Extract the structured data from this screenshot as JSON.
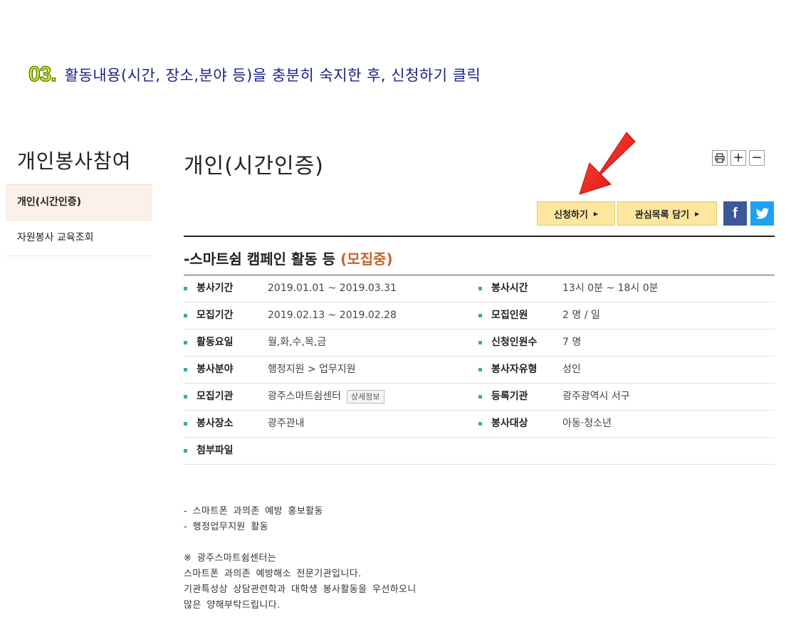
{
  "instruction": {
    "step": "03.",
    "text": "활동내용(시간, 장소,분야 등)을 충분히 숙지한 후, 신청하기 클릭"
  },
  "sidebar": {
    "title": "개인봉사참여",
    "items": [
      {
        "label": "개인(시간인증)",
        "active": true
      },
      {
        "label": "자원봉사 교육조회",
        "active": false
      }
    ]
  },
  "main": {
    "title": "개인(시간인증)",
    "tools": [
      {
        "icon": "print-icon",
        "symbol": "🖶"
      },
      {
        "icon": "zoom-in-icon",
        "symbol": "+"
      },
      {
        "icon": "zoom-out-icon",
        "symbol": "−"
      }
    ],
    "apply_label": "신청하기",
    "favorite_label": "관심목록 담기",
    "facebook_label": "f",
    "activity_title": "-스마트쉼 캠페인 활동 등",
    "activity_status": "(모집중)",
    "status_color": "#c8622a",
    "accent_color": "#fde69d"
  },
  "info": {
    "rows": [
      {
        "label1": "봉사기간",
        "value1": "2019.01.01 ~ 2019.03.31",
        "label2": "봉사시간",
        "value2": "13시 0분 ~ 18시 0분"
      },
      {
        "label1": "모집기간",
        "value1": "2019.02.13 ~ 2019.02.28",
        "label2": "모집인원",
        "value2": "2 명 / 일"
      },
      {
        "label1": "활동요일",
        "value1": "월,화,수,목,금",
        "label2": "신청인원수",
        "value2": "7 명"
      },
      {
        "label1": "봉사분야",
        "value1": "행정지원 > 업무지원",
        "label2": "봉사자유형",
        "value2": "성인"
      },
      {
        "label1": "모집기관",
        "value1": "광주스마트쉼센터",
        "badge": "상세정보",
        "label2": "등록기관",
        "value2": "광주광역시 서구"
      },
      {
        "label1": "봉사장소",
        "value1": "광주관내",
        "label2": "봉사대상",
        "value2": "아동·청소년"
      },
      {
        "label1": "첨부파일",
        "value1": "",
        "label2": "",
        "value2": ""
      }
    ]
  },
  "description": {
    "lines": [
      "- 스마트폰 과의존 예방 홍보활동",
      "- 행정업무지원 활동",
      "",
      "※ 광주스마트쉼센터는",
      "스마트폰 과의존 예방해소 전문기관입니다.",
      "기관특성상 상담관련학과 대학생 봉사활동을 우선하오니",
      "많은 양해부탁드립니다."
    ]
  }
}
